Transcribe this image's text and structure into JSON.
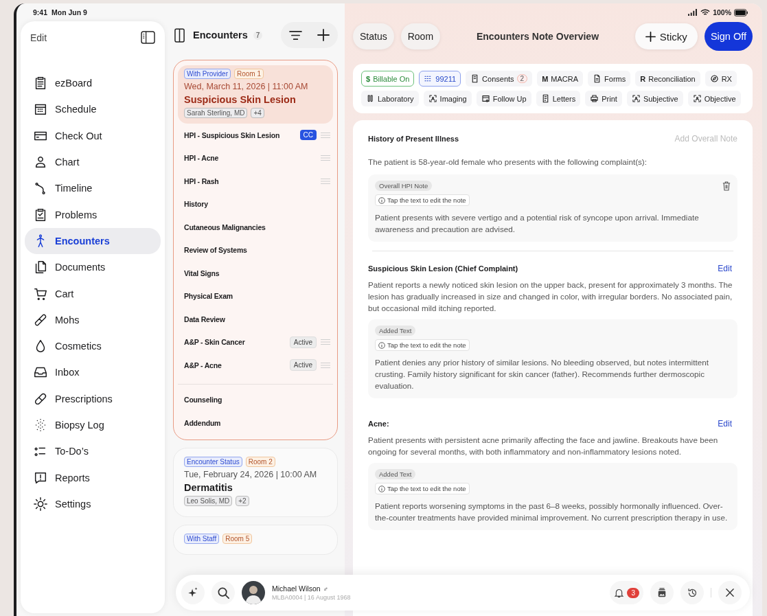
{
  "status_bar": {
    "time": "9:41",
    "date": "Mon Jun 9",
    "battery": "100%"
  },
  "sidebar": {
    "edit_label": "Edit",
    "items": [
      {
        "label": "ezBoard",
        "selected": false
      },
      {
        "label": "Schedule",
        "selected": false
      },
      {
        "label": "Check Out",
        "selected": false
      },
      {
        "label": "Chart",
        "selected": false
      },
      {
        "label": "Timeline",
        "selected": false
      },
      {
        "label": "Problems",
        "selected": false
      },
      {
        "label": "Encounters",
        "selected": true
      },
      {
        "label": "Documents",
        "selected": false
      },
      {
        "label": "Cart",
        "selected": false
      },
      {
        "label": "Mohs",
        "selected": false
      },
      {
        "label": "Cosmetics",
        "selected": false
      },
      {
        "label": "Inbox",
        "selected": false
      },
      {
        "label": "Prescriptions",
        "selected": false
      },
      {
        "label": "Biopsy Log",
        "selected": false
      },
      {
        "label": "To-Do’s",
        "selected": false
      },
      {
        "label": "Reports",
        "selected": false
      },
      {
        "label": "Settings",
        "selected": false
      }
    ]
  },
  "encounters": {
    "title": "Encounters",
    "count": "7",
    "cards": [
      {
        "status": "With Provider",
        "room": "Room 1",
        "datetime": "Wed, March 11, 2026 | 11:00 AM",
        "title": "Suspicious Skin Lesion",
        "provider": "Sarah Sterling, MD",
        "more": "+4",
        "selected": true,
        "sections": [
          {
            "label": "HPI - Suspicious Skin Lesion",
            "badge": "CC",
            "kind": "primary",
            "draggable": true
          },
          {
            "label": "HPI - Acne",
            "draggable": true
          },
          {
            "label": "HPI - Rash",
            "draggable": true
          },
          {
            "label": "History",
            "draggable": false
          },
          {
            "label": "Cutaneous Malignancies",
            "draggable": false
          },
          {
            "label": "Review of Systems",
            "draggable": false
          },
          {
            "label": "Vital Signs",
            "draggable": false
          },
          {
            "label": "Physical Exam",
            "draggable": false
          },
          {
            "label": "Data Review",
            "draggable": false
          },
          {
            "label": "A&P - Skin Cancer",
            "badge": "Active",
            "kind": "neutral",
            "draggable": true
          },
          {
            "label": "A&P - Acne",
            "badge": "Active",
            "kind": "neutral",
            "draggable": true
          }
        ],
        "extra_sections": [
          {
            "label": "Counseling"
          },
          {
            "label": "Addendum"
          }
        ]
      },
      {
        "status": "Encounter Status",
        "room": "Room 2",
        "datetime": "Tue, February 24, 2026 | 10:00 AM",
        "title": "Dermatitis",
        "provider": "Leo Solis, MD",
        "more": "+2",
        "selected": false
      },
      {
        "status": "With Staff",
        "room": "Room 5",
        "selected": false
      }
    ]
  },
  "header": {
    "buttons": [
      "Status",
      "Room"
    ],
    "title": "Encounters Note Overview",
    "sticky": "Sticky",
    "sign_off": "Sign Off"
  },
  "toolbar": [
    {
      "label": "Billable On",
      "kind": "billable",
      "prefix": "$"
    },
    {
      "label": "99211",
      "kind": "code"
    },
    {
      "label": "Consents",
      "kind": "tool",
      "count": "2"
    },
    {
      "label": "MACRA",
      "kind": "tool",
      "prefix": "M"
    },
    {
      "label": "Forms",
      "kind": "tool"
    },
    {
      "label": "Reconciliation",
      "kind": "tool",
      "prefix": "R"
    },
    {
      "label": "RX",
      "kind": "tool"
    },
    {
      "label": "Laboratory",
      "kind": "tool"
    },
    {
      "label": "Imaging",
      "kind": "tool"
    },
    {
      "label": "Follow Up",
      "kind": "tool"
    },
    {
      "label": "Letters",
      "kind": "tool"
    },
    {
      "label": "Print",
      "kind": "tool"
    },
    {
      "label": "Subjective",
      "kind": "tool"
    },
    {
      "label": "Objective",
      "kind": "tool"
    }
  ],
  "note": {
    "heading": "History of Present Illness",
    "add_action": "Add Overall Note",
    "intro": "The patient is 58-year-old female who presents with the following complaint(s):",
    "overall": {
      "tag": "Overall HPI Note",
      "hint": "Tap the text to edit the note",
      "text": "Patient presents with severe vertigo and a potential risk of syncope upon arrival. Immediate awareness and precaution are advised.",
      "deletable": true
    },
    "complaints": [
      {
        "title": "Suspicious Skin Lesion (Chief Complaint)",
        "action": "Edit",
        "text": "Patient reports a newly noticed skin lesion on the upper back, present for approximately 3 months. The lesion has gradually increased in size and changed in color, with irregular borders. No associated pain, but occasional mild itching reported.",
        "added": {
          "tag": "Added Text",
          "hint": "Tap the text to edit the note",
          "text": "Patient denies any prior history of similar lesions. No bleeding observed, but notes intermittent crusting. Family history significant for skin cancer (father). Recommends further dermoscopic evaluation."
        }
      },
      {
        "title": "Acne:",
        "action": "Edit",
        "text": "Patient presents with persistent acne primarily affecting the face and jawline. Breakouts have been ongoing for several months, with both inflammatory and non-inflammatory lesions noted.",
        "added": {
          "tag": "Added Text",
          "hint": "Tap the text to edit the note",
          "text": "Patient reports worsening symptoms in the past 6–8 weeks, possibly hormonally influenced. Over-the-counter treatments have provided minimal improvement. No current prescription therapy in use."
        }
      }
    ]
  },
  "patient_bar": {
    "name": "Michael Wilson",
    "gender": "♂",
    "details": "MLBA0004 | 16 August 1968",
    "notifications": "3"
  }
}
